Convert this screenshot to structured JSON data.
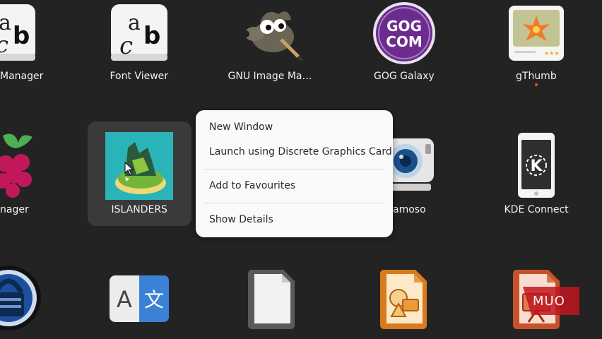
{
  "apps": {
    "row1": [
      {
        "label": "Manager",
        "icon": "font-manager-icon"
      },
      {
        "label": "Font Viewer",
        "icon": "font-viewer-icon"
      },
      {
        "label": "GNU Image Ma…",
        "icon": "gimp-icon"
      },
      {
        "label": "GOG Galaxy",
        "icon": "gog-galaxy-icon"
      },
      {
        "label": "gThumb",
        "icon": "gthumb-icon",
        "running": true
      }
    ],
    "row2": [
      {
        "label": "nager",
        "icon": "raspberry-pi-imager-icon"
      },
      {
        "label": "ISLANDERS",
        "icon": "islanders-icon",
        "selected": true
      },
      {
        "label": "amoso",
        "icon": "webcam-icon"
      },
      {
        "label": "KDE Connect",
        "icon": "kde-connect-icon"
      }
    ],
    "row3": [
      {
        "icon": "keepassxc-icon"
      },
      {
        "icon": "translator-icon",
        "glyphs": [
          "A",
          "文"
        ]
      },
      {
        "icon": "libreoffice-icon"
      },
      {
        "icon": "libreoffice-draw-icon"
      },
      {
        "icon": "libreoffice-impress-icon"
      }
    ]
  },
  "icon_text": {
    "font_letters": [
      "a",
      "c",
      "b"
    ],
    "gog": [
      "GOG",
      "COM"
    ]
  },
  "context_menu": {
    "items": [
      "New Window",
      "Launch using Discrete Graphics Card",
      "Add to Favourites",
      "Show Details"
    ]
  },
  "watermark": "MUO",
  "colors": {
    "background": "#232323",
    "menu": "#fafafa",
    "accent_dot": "#e95420",
    "gog_purple": "#6c2b8f"
  }
}
